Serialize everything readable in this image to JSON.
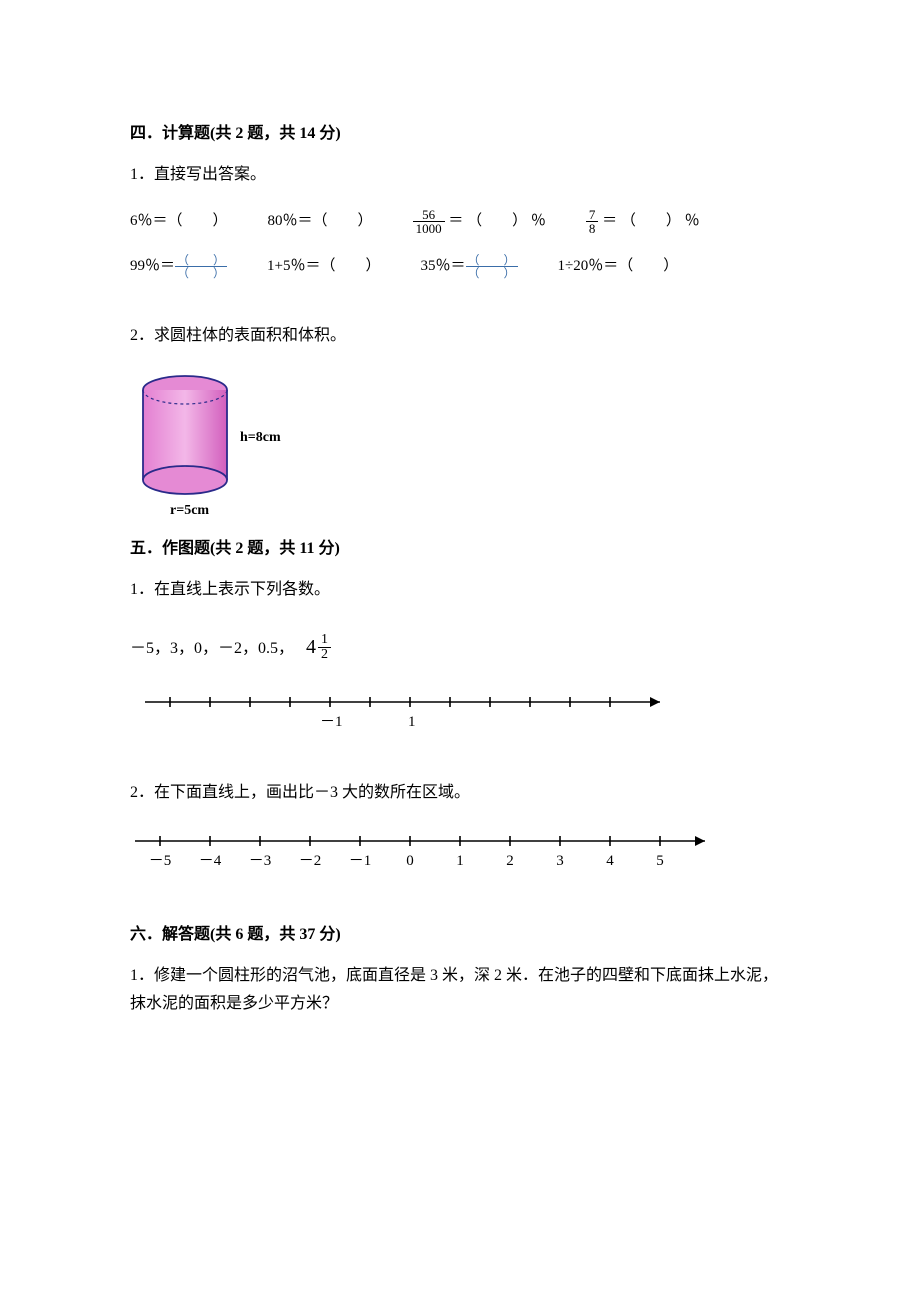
{
  "section4": {
    "title": "四．计算题(共 2 题，共 14 分)",
    "q1": {
      "num": "1．直接写出答案。",
      "row1": {
        "c1_left": "6％＝",
        "c2_left": "80％＝",
        "c3_frac_top": "56",
        "c3_frac_bot": "1000",
        "c3_mid": " ＝ ",
        "c3_right": " ％",
        "c4_frac_top": "7",
        "c4_frac_bot": "8",
        "c4_mid": " ＝ ",
        "c4_right": " ％"
      },
      "row2": {
        "c1_left": "99％＝",
        "c2_left": "1+5％＝",
        "c3_left": "35％＝",
        "c4_left": "1÷20％＝"
      },
      "blank_paren": "（　　）",
      "blank_frac_top": "（　　）",
      "blank_frac_bot": "（　　）"
    },
    "q2": {
      "num": "2．求圆柱体的表面积和体积。",
      "h": "h=8cm",
      "r": "r=5cm"
    }
  },
  "section5": {
    "title": "五．作图题(共 2 题，共 11 分)",
    "q1": {
      "num": "1．在直线上表示下列各数。",
      "values_plain": "－5，3，0，－2，0.5，",
      "mixed_whole": "4",
      "mixed_top": "1",
      "mixed_bot": "2",
      "tick_neg1": "－1",
      "tick_pos1": "1"
    },
    "q2": {
      "num": "2．在下面直线上，画出比－3 大的数所在区域。",
      "labels": [
        "－5",
        "－4",
        "－3",
        "－2",
        "－1",
        "0",
        "1",
        "2",
        "3",
        "4",
        "5"
      ]
    }
  },
  "section6": {
    "title": "六．解答题(共 6 题，共 37 分)",
    "q1": "1．修建一个圆柱形的沼气池，底面直径是 3 米，深 2 米．在池子的四壁和下底面抹上水泥，抹水泥的面积是多少平方米？"
  }
}
